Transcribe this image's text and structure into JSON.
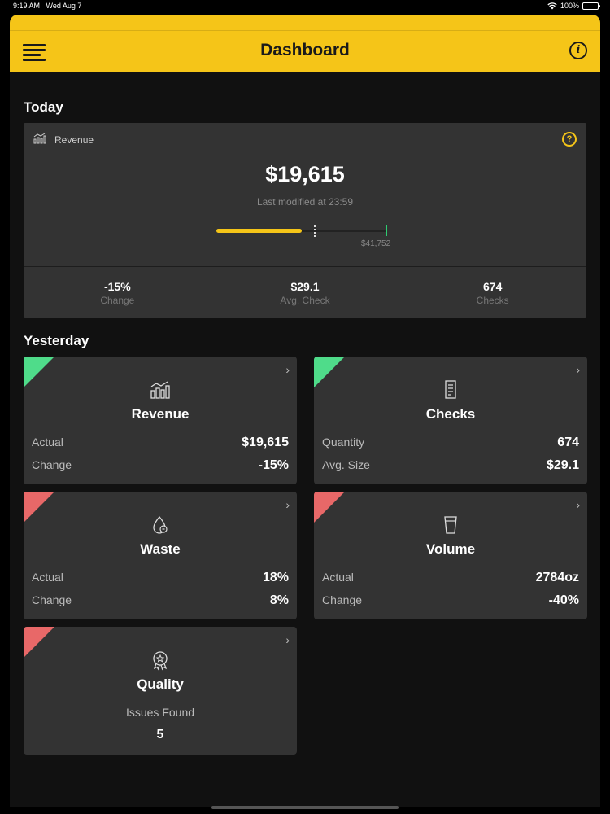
{
  "status_bar": {
    "time": "9:19 AM",
    "date": "Wed Aug 7",
    "battery": "100%"
  },
  "header": {
    "title": "Dashboard",
    "menu_icon": "hamburger-icon",
    "info_icon": "info-icon",
    "accent": "#f5c518"
  },
  "today": {
    "section_title": "Today",
    "card_label": "Revenue",
    "help_icon": "help-icon",
    "value": "$19,615",
    "modified": "Last modified at 23:59",
    "progress": {
      "actual_fraction": 0.5,
      "marker_fraction": 0.57,
      "goal_fraction": 1.0,
      "goal_label": "$41,752"
    },
    "stats": [
      {
        "value": "-15%",
        "label": "Change"
      },
      {
        "value": "$29.1",
        "label": "Avg. Check"
      },
      {
        "value": "674",
        "label": "Checks"
      }
    ]
  },
  "yesterday": {
    "section_title": "Yesterday",
    "colors": {
      "good": "#4fdc8a",
      "bad": "#e86868"
    },
    "tiles": {
      "revenue": {
        "name": "Revenue",
        "icon": "bar-chart-icon",
        "status": "good",
        "rows": [
          {
            "label": "Actual",
            "value": "$19,615"
          },
          {
            "label": "Change",
            "value": "-15%"
          }
        ]
      },
      "checks": {
        "name": "Checks",
        "icon": "receipt-icon",
        "status": "good",
        "rows": [
          {
            "label": "Quantity",
            "value": "674"
          },
          {
            "label": "Avg. Size",
            "value": "$29.1"
          }
        ]
      },
      "waste": {
        "name": "Waste",
        "icon": "drop-icon",
        "status": "bad",
        "rows": [
          {
            "label": "Actual",
            "value": "18%"
          },
          {
            "label": "Change",
            "value": "8%"
          }
        ]
      },
      "volume": {
        "name": "Volume",
        "icon": "glass-icon",
        "status": "bad",
        "rows": [
          {
            "label": "Actual",
            "value": "2784oz"
          },
          {
            "label": "Change",
            "value": "-40%"
          }
        ]
      },
      "quality": {
        "name": "Quality",
        "icon": "award-icon",
        "status": "bad",
        "label": "Issues Found",
        "value": "5"
      }
    }
  }
}
